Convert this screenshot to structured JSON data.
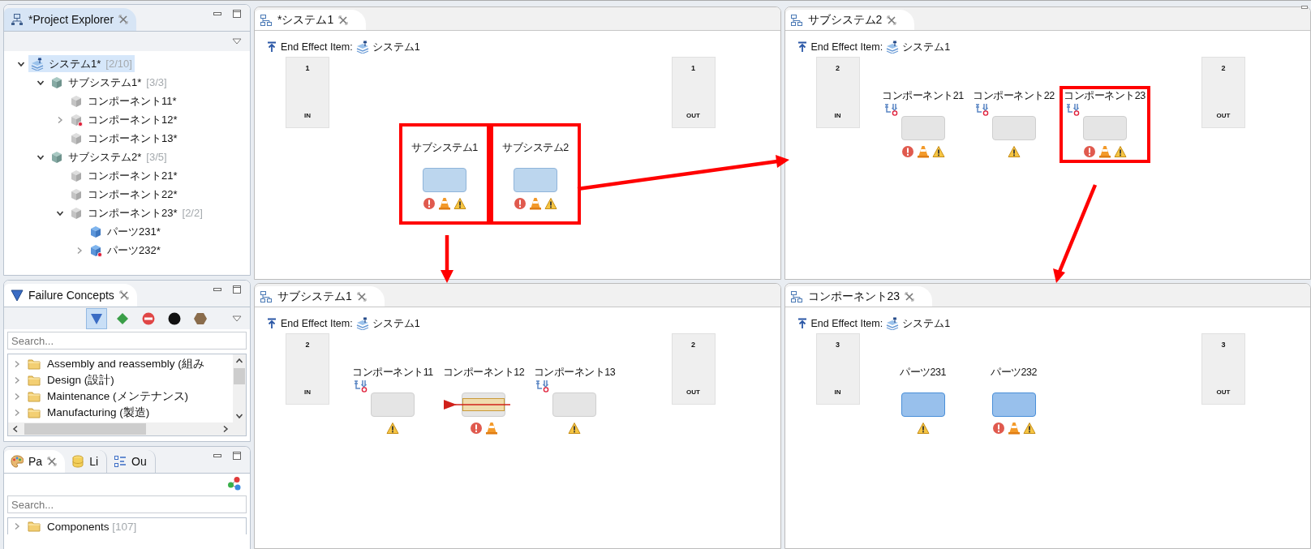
{
  "project_explorer": {
    "title": "*Project Explorer",
    "active": true,
    "tree": [
      {
        "label": "システム1*",
        "count": "[2/10]",
        "kind": "system",
        "expandable": true,
        "expanded": true,
        "flagged": false,
        "selected": true,
        "children": [
          {
            "label": "サブシステム1*",
            "count": "[3/3]",
            "kind": "subsystem",
            "expandable": true,
            "expanded": true,
            "flagged": false,
            "selected": false,
            "children": [
              {
                "label": "コンポーネント11*",
                "kind": "component",
                "expandable": false,
                "flagged": false,
                "selected": false
              },
              {
                "label": "コンポーネント12*",
                "kind": "component",
                "expandable": true,
                "expanded": false,
                "flagged": true,
                "selected": false
              },
              {
                "label": "コンポーネント13*",
                "kind": "component",
                "expandable": false,
                "flagged": false,
                "selected": false
              }
            ]
          },
          {
            "label": "サブシステム2*",
            "count": "[3/5]",
            "kind": "subsystem",
            "expandable": true,
            "expanded": true,
            "flagged": false,
            "selected": false,
            "children": [
              {
                "label": "コンポーネント21*",
                "kind": "component",
                "expandable": false,
                "flagged": false,
                "selected": false
              },
              {
                "label": "コンポーネント22*",
                "kind": "component",
                "expandable": false,
                "flagged": false,
                "selected": false
              },
              {
                "label": "コンポーネント23*",
                "count": "[2/2]",
                "kind": "component",
                "expandable": true,
                "expanded": true,
                "flagged": false,
                "selected": false,
                "children": [
                  {
                    "label": "パーツ231*",
                    "kind": "part",
                    "expandable": false,
                    "flagged": false,
                    "selected": false
                  },
                  {
                    "label": "パーツ232*",
                    "kind": "part",
                    "expandable": true,
                    "expanded": false,
                    "flagged": true,
                    "selected": false
                  }
                ]
              }
            ]
          }
        ]
      }
    ]
  },
  "failure_concepts": {
    "title": "Failure Concepts",
    "active": false,
    "filters": [
      {
        "kind": "triangle",
        "color": "#3a6cc4",
        "selected": true
      },
      {
        "kind": "diamond",
        "color": "#3a9e48",
        "selected": false
      },
      {
        "kind": "no-entry",
        "color": "#e04646",
        "selected": false
      },
      {
        "kind": "circle",
        "color": "#111111",
        "selected": false
      },
      {
        "kind": "hexagon",
        "color": "#8a6c4c",
        "selected": false
      }
    ],
    "search": {
      "placeholder": "Search..."
    },
    "items": [
      {
        "label": "Assembly and reassembly (組み"
      },
      {
        "label": "Design (設計)"
      },
      {
        "label": "Maintenance (メンテナンス)"
      },
      {
        "label": "Manufacturing (製造)"
      }
    ]
  },
  "palette": {
    "tabs": [
      {
        "label": "Pa",
        "kind": "palette",
        "selected": true
      },
      {
        "label": "Li",
        "kind": "library",
        "selected": false
      },
      {
        "label": "Ou",
        "kind": "outline",
        "selected": false
      }
    ],
    "search": {
      "placeholder": "Search..."
    },
    "items": [
      {
        "label": "Components",
        "count": "[107]"
      }
    ]
  },
  "editors": [
    {
      "title": "*システム1",
      "end_effect_label": "End Effect Item:",
      "end_effect_item": "システム1",
      "in_port": {
        "number": "1",
        "label": "IN"
      },
      "out_port": {
        "number": "1",
        "label": "OUT"
      },
      "nodes": [
        {
          "label": "サブシステム1",
          "kind": "subsystem",
          "trace": false,
          "highlighted": false,
          "callout": true,
          "markers": [
            {
              "kind": "error"
            },
            {
              "kind": "cone"
            },
            {
              "kind": "warning"
            }
          ]
        },
        {
          "label": "サブシステム2",
          "kind": "subsystem",
          "trace": false,
          "highlighted": false,
          "callout": true,
          "markers": [
            {
              "kind": "error"
            },
            {
              "kind": "cone"
            },
            {
              "kind": "warning"
            }
          ]
        }
      ]
    },
    {
      "title": "サブシステム2",
      "end_effect_label": "End Effect Item:",
      "end_effect_item": "システム1",
      "in_port": {
        "number": "2",
        "label": "IN"
      },
      "out_port": {
        "number": "2",
        "label": "OUT"
      },
      "nodes": [
        {
          "label": "コンポーネント21",
          "kind": "component",
          "trace": true,
          "highlighted": false,
          "callout": false,
          "markers": [
            {
              "kind": "error"
            },
            {
              "kind": "cone"
            },
            {
              "kind": "warning"
            }
          ]
        },
        {
          "label": "コンポーネント22",
          "kind": "component",
          "trace": true,
          "highlighted": false,
          "callout": false,
          "markers": [
            {
              "kind": "warning"
            }
          ]
        },
        {
          "label": "コンポーネント23",
          "kind": "component",
          "trace": true,
          "highlighted": false,
          "callout": true,
          "markers": [
            {
              "kind": "error"
            },
            {
              "kind": "cone"
            },
            {
              "kind": "warning"
            }
          ]
        }
      ]
    },
    {
      "title": "サブシステム1",
      "end_effect_label": "End Effect Item:",
      "end_effect_item": "システム1",
      "in_port": {
        "number": "2",
        "label": "IN"
      },
      "out_port": {
        "number": "2",
        "label": "OUT"
      },
      "nodes": [
        {
          "label": "コンポーネント11",
          "kind": "component",
          "trace": true,
          "highlighted": false,
          "callout": false,
          "markers": [
            {
              "kind": "warning"
            }
          ]
        },
        {
          "label": "コンポーネント12",
          "kind": "component",
          "trace": false,
          "highlighted": true,
          "callout": false,
          "markers": [
            {
              "kind": "error"
            },
            {
              "kind": "cone"
            }
          ]
        },
        {
          "label": "コンポーネント13",
          "kind": "component",
          "trace": true,
          "highlighted": false,
          "callout": false,
          "markers": [
            {
              "kind": "warning"
            }
          ]
        }
      ]
    },
    {
      "title": "コンポーネント23",
      "end_effect_label": "End Effect Item:",
      "end_effect_item": "システム1",
      "in_port": {
        "number": "3",
        "label": "IN"
      },
      "out_port": {
        "number": "3",
        "label": "OUT"
      },
      "nodes": [
        {
          "label": "パーツ231",
          "kind": "part",
          "trace": false,
          "highlighted": false,
          "callout": false,
          "markers": [
            {
              "kind": "warning"
            }
          ]
        },
        {
          "label": "パーツ232",
          "kind": "part",
          "trace": false,
          "highlighted": false,
          "callout": false,
          "markers": [
            {
              "kind": "error"
            },
            {
              "kind": "cone"
            },
            {
              "kind": "warning"
            }
          ]
        }
      ]
    }
  ]
}
